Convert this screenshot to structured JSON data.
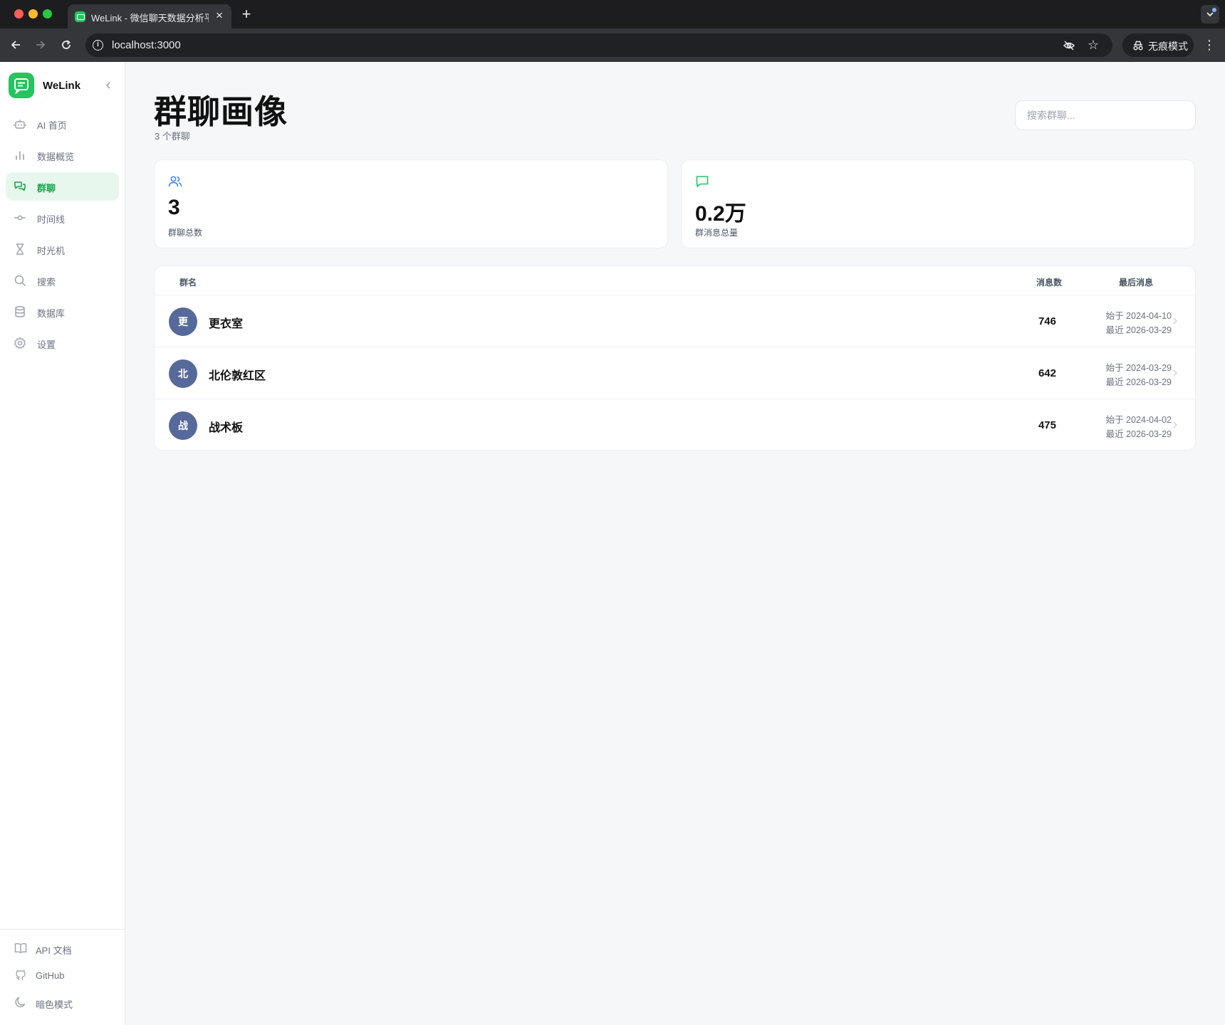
{
  "browser": {
    "tab_title": "WeLink - 微信聊天数据分析平台",
    "url": "localhost:3000",
    "incognito_label": "无痕模式"
  },
  "sidebar": {
    "brand": "WeLink",
    "items": [
      {
        "label": "AI 首页",
        "icon": "robot-icon"
      },
      {
        "label": "数据概览",
        "icon": "bar-chart-icon"
      },
      {
        "label": "群聊",
        "icon": "chat-bubbles-icon",
        "active": true
      },
      {
        "label": "时间线",
        "icon": "timeline-icon"
      },
      {
        "label": "时光机",
        "icon": "hourglass-icon"
      },
      {
        "label": "搜索",
        "icon": "search-icon"
      },
      {
        "label": "数据库",
        "icon": "database-icon"
      },
      {
        "label": "设置",
        "icon": "gear-icon"
      }
    ],
    "footer": [
      {
        "label": "API 文档",
        "icon": "book-icon"
      },
      {
        "label": "GitHub",
        "icon": "github-icon"
      },
      {
        "label": "暗色模式",
        "icon": "moon-icon"
      }
    ]
  },
  "page": {
    "title": "群聊画像",
    "subtitle": "3 个群聊",
    "search_placeholder": "搜索群聊..."
  },
  "stats": [
    {
      "value": "3",
      "label": "群聊总数",
      "icon": "users-icon",
      "color": "#3b82f6"
    },
    {
      "value": "0.2万",
      "label": "群消息总量",
      "icon": "message-icon",
      "color": "#22c55e"
    }
  ],
  "table": {
    "headers": {
      "name": "群名",
      "count": "消息数",
      "last": "最后消息"
    },
    "rows": [
      {
        "avatar": "更",
        "name": "更衣室",
        "count": "746",
        "since": "始于 2024-04-10",
        "recent": "最近 2026-03-29"
      },
      {
        "avatar": "北",
        "name": "北伦敦红区",
        "count": "642",
        "since": "始于 2024-03-29",
        "recent": "最近 2026-03-29"
      },
      {
        "avatar": "战",
        "name": "战术板",
        "count": "475",
        "since": "始于 2024-04-02",
        "recent": "最近 2026-03-29"
      }
    ]
  },
  "colors": {
    "accent": "#22c55e",
    "avatar": "#57699a",
    "active_bg": "#e8f7ee"
  }
}
